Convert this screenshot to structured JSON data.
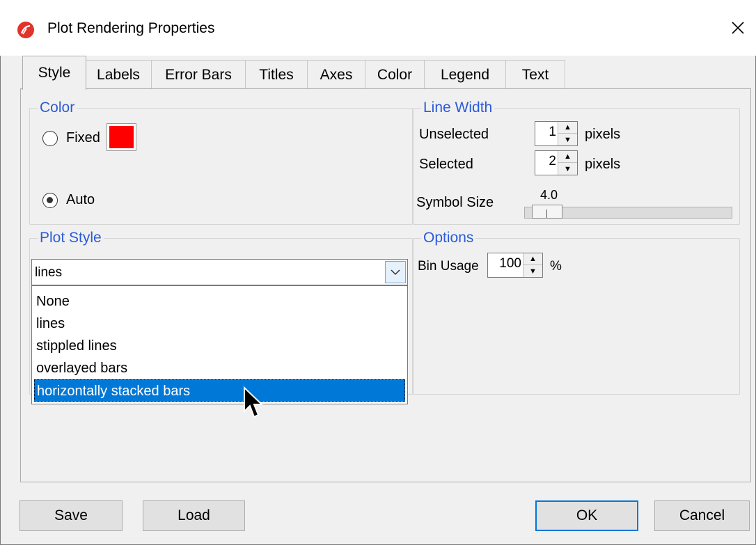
{
  "window": {
    "title": "Plot Rendering Properties"
  },
  "tabs": [
    {
      "label": "Style",
      "active": true
    },
    {
      "label": "Labels"
    },
    {
      "label": "Error Bars"
    },
    {
      "label": "Titles"
    },
    {
      "label": "Axes"
    },
    {
      "label": "Color"
    },
    {
      "label": "Legend"
    },
    {
      "label": "Text"
    }
  ],
  "color_group": {
    "legend": "Color",
    "fixed_label": "Fixed",
    "auto_label": "Auto",
    "selected": "Auto",
    "fixed_color": "#ff0000"
  },
  "line_width": {
    "legend": "Line Width",
    "unselected_label": "Unselected",
    "unselected_value": "1",
    "selected_label": "Selected",
    "selected_value": "2",
    "unit": "pixels",
    "symbol_size_label": "Symbol Size",
    "symbol_size_value": "4.0"
  },
  "plot_style": {
    "legend": "Plot Style",
    "current_value": "lines",
    "options": [
      "None",
      "lines",
      "stippled lines",
      "overlayed bars",
      "horizontally stacked bars"
    ],
    "highlighted": "horizontally stacked bars"
  },
  "options_group": {
    "legend": "Options",
    "bin_usage_label": "Bin Usage",
    "bin_usage_value": "100",
    "bin_usage_unit": "%"
  },
  "buttons": {
    "save": "Save",
    "load": "Load",
    "ok": "OK",
    "cancel": "Cancel"
  },
  "colors": {
    "accent_blue": "#0078d7",
    "legend_blue": "#2a5bd7"
  }
}
